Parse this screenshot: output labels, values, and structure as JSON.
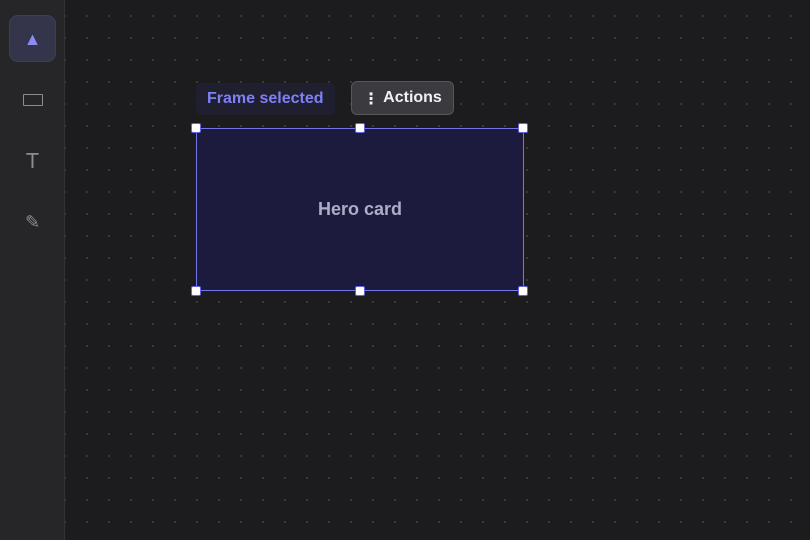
{
  "toolbar": {
    "tools": [
      {
        "name": "select",
        "icon": "triangle-pointer-icon",
        "active": true
      },
      {
        "name": "rectangle",
        "icon": "rectangle-icon",
        "active": false
      },
      {
        "name": "text",
        "icon": "text-icon",
        "glyph": "T",
        "active": false
      },
      {
        "name": "pen",
        "icon": "pencil-icon",
        "glyph": "✎",
        "active": false
      }
    ]
  },
  "selection": {
    "label": "Frame selected",
    "actions_label": "Actions",
    "actions_icon": "more-vertical-icon"
  },
  "frame": {
    "label": "Hero card"
  },
  "colors": {
    "accent": "#7f80f4",
    "frame_fill": "#1c1b3e",
    "frame_border": "#7475e8",
    "canvas_bg": "#1c1c1f",
    "toolbar_bg": "#262629"
  }
}
